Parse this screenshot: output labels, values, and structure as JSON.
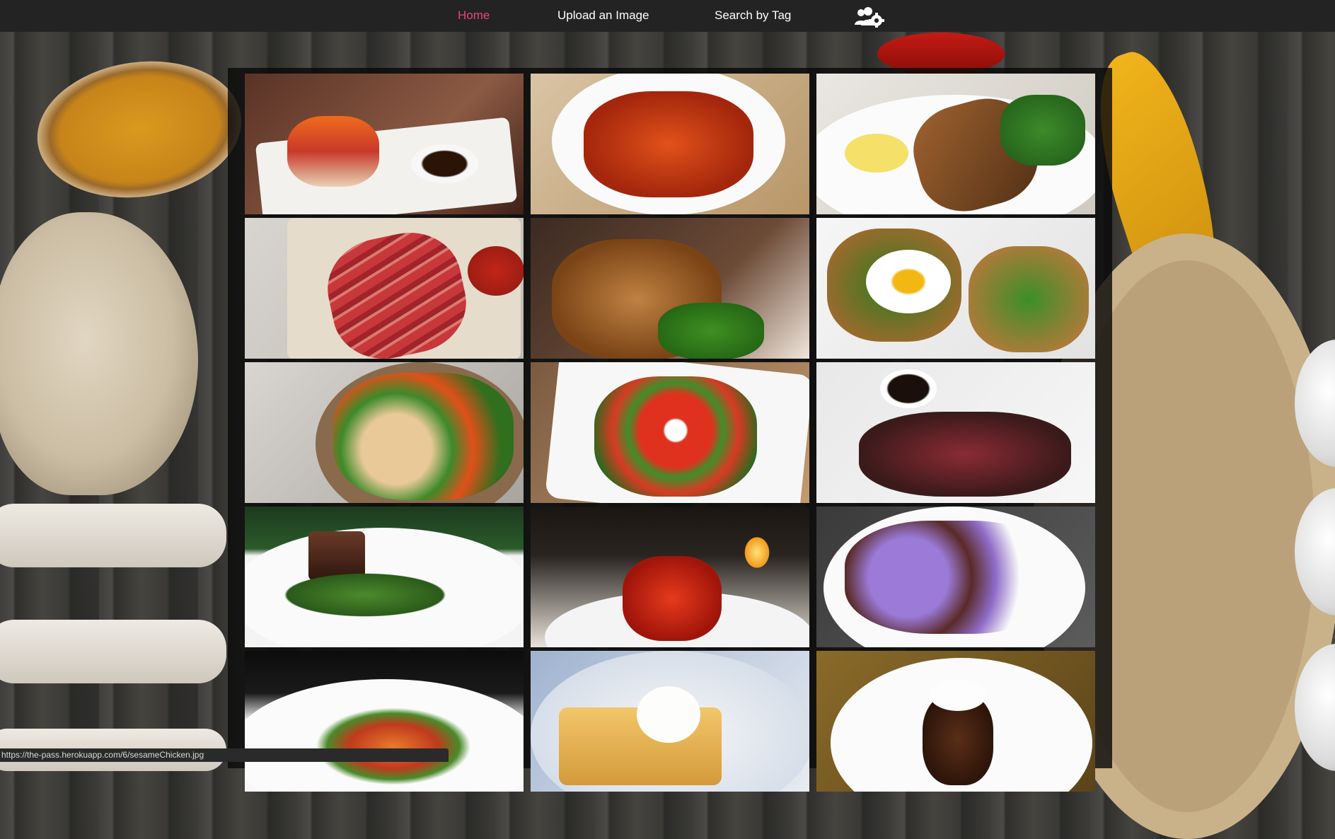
{
  "nav": {
    "home": "Home",
    "upload": "Upload an Image",
    "search": "Search by Tag",
    "users_icon": "users-gear-icon",
    "active_color": "#e8457a"
  },
  "gallery": {
    "images": [
      {
        "name": "sushi-dish-image"
      },
      {
        "name": "sweet-sour-chicken-image"
      },
      {
        "name": "crusted-salmon-image"
      },
      {
        "name": "bacon-meatloaf-image"
      },
      {
        "name": "roast-chicken-broccoli-image"
      },
      {
        "name": "egg-toast-salad-image"
      },
      {
        "name": "chicken-salad-bowl-image"
      },
      {
        "name": "tomato-mozzarella-salad-image"
      },
      {
        "name": "seared-tuna-image"
      },
      {
        "name": "beef-fillet-plate-image"
      },
      {
        "name": "lobster-dinner-image"
      },
      {
        "name": "octopus-plate-image"
      },
      {
        "name": "plated-starter-image"
      },
      {
        "name": "cheesecake-dessert-image"
      },
      {
        "name": "chocolate-dessert-image"
      }
    ]
  },
  "status_url": "https://the-pass.herokuapp.com/6/sesameChicken.jpg"
}
